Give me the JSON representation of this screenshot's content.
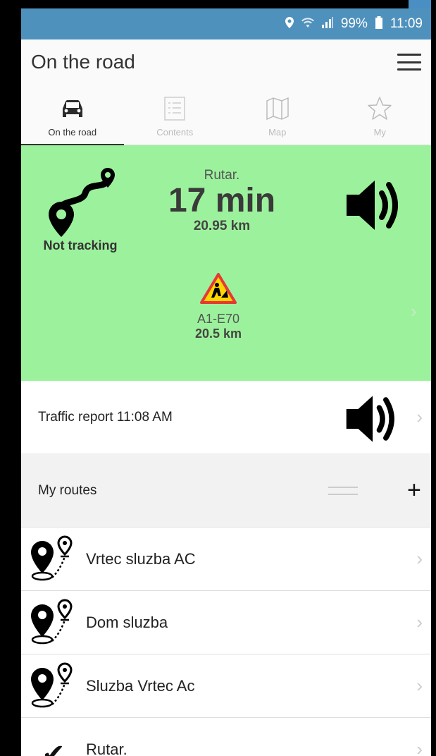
{
  "status_bar": {
    "location_icon": "location-pin-icon",
    "wifi_icon": "wifi-icon",
    "signal_icon": "signal-icon",
    "battery": "99%",
    "battery_icon": "battery-icon",
    "time": "11:09"
  },
  "header": {
    "title": "On the road",
    "menu_icon": "hamburger-menu-icon"
  },
  "tabs": [
    {
      "label": "On the road",
      "icon": "car-icon",
      "active": true
    },
    {
      "label": "Contents",
      "icon": "list-icon",
      "active": false
    },
    {
      "label": "Map",
      "icon": "map-icon",
      "active": false
    },
    {
      "label": "My",
      "icon": "star-icon",
      "active": false
    }
  ],
  "status_panel": {
    "tracking_label": "Not tracking",
    "route_name": "Rutar.",
    "route_time": "17 min",
    "route_distance": "20.95 km",
    "incident_road": "A1-E70",
    "incident_distance": "20.5 km",
    "background": "#9cf29c"
  },
  "traffic": {
    "label": "Traffic report 11:08 AM"
  },
  "routes": {
    "title": "My routes",
    "add_label": "+",
    "items": [
      {
        "label": "Vrtec sluzba AC",
        "icon": "route-pins-icon"
      },
      {
        "label": "Dom sluzba",
        "icon": "route-pins-icon"
      },
      {
        "label": "Sluzba Vrtec Ac",
        "icon": "route-pins-icon"
      },
      {
        "label": "Rutar.",
        "icon": "checkmark-icon"
      }
    ]
  },
  "chevron": "›",
  "colors": {
    "status_bar": "#4f91bd",
    "panel_green": "#9cf29c",
    "warning_red": "#e53935",
    "warning_yellow": "#ffd400"
  }
}
